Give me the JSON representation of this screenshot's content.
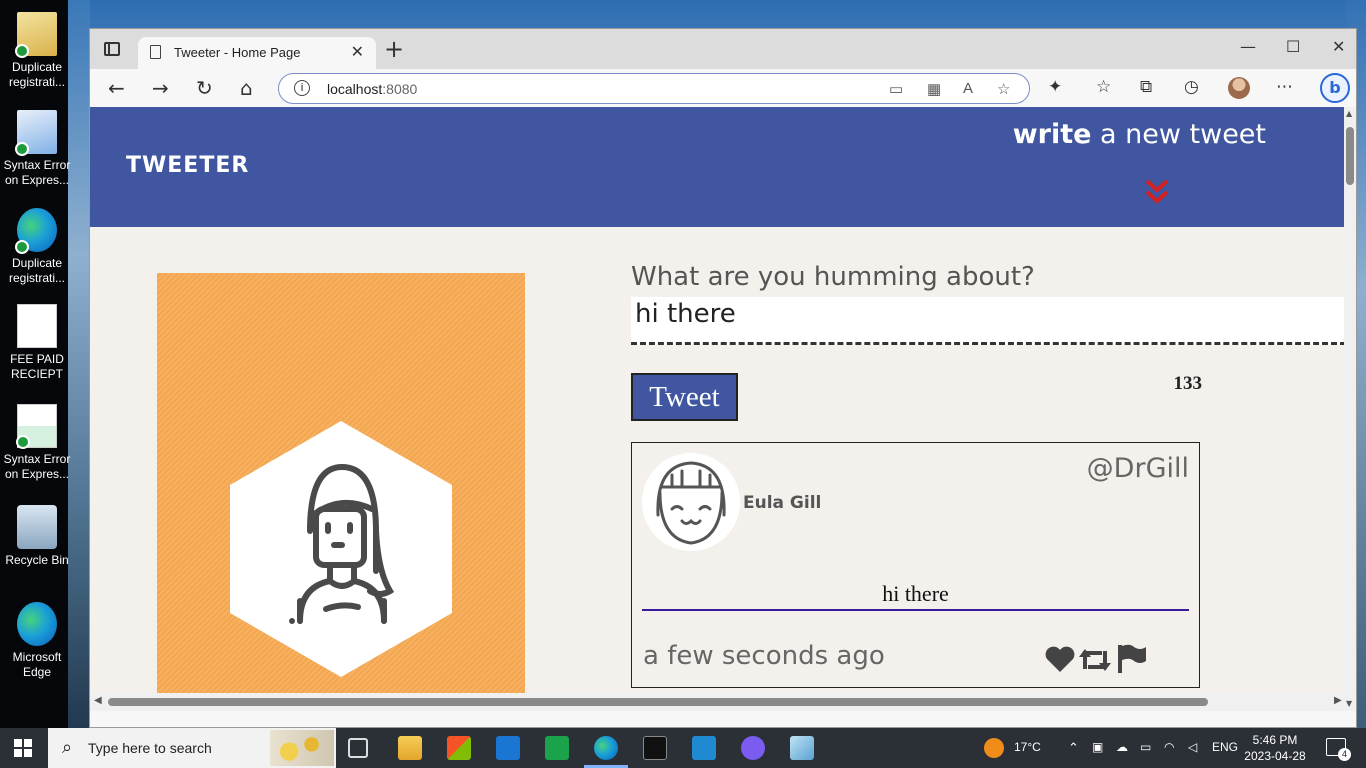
{
  "desktop": {
    "icons": [
      {
        "label": "Duplicate registrati...",
        "icon": "folder-file-icon"
      },
      {
        "label": "Syntax Error on Expres...",
        "icon": "document-icon"
      },
      {
        "label": "Duplicate registrati...",
        "icon": "edge-icon"
      },
      {
        "label": "FEE PAID RECIEPT",
        "icon": "pdf-document-icon"
      },
      {
        "label": "Syntax Error on Expres...",
        "icon": "document-icon"
      },
      {
        "label": "Recycle Bin",
        "icon": "recycle-bin-icon"
      },
      {
        "label": "Microsoft Edge",
        "icon": "edge-icon"
      }
    ]
  },
  "browser": {
    "tab_title": "Tweeter - Home Page",
    "url_host": "localhost",
    "url_port": ":8080"
  },
  "page": {
    "brand": "TWEETER",
    "write_bold": "write",
    "write_rest": " a new tweet",
    "compose_label": "What are you humming about?",
    "compose_value": "hi there",
    "tweet_button": "Tweet",
    "char_counter": "133",
    "tweet": {
      "name": "Eula Gill",
      "handle": "@DrGill",
      "content": "hi there",
      "time": "a few seconds ago"
    },
    "colors": {
      "nav": "#4156a1",
      "panel": "#f9ab55",
      "background": "#f4f1ec",
      "chevron": "#d32020"
    }
  },
  "taskbar": {
    "search_placeholder": "Type here to search",
    "weather": "17°C",
    "language": "ENG",
    "time": "5:46 PM",
    "date": "2023-04-28",
    "notification_count": "4"
  }
}
